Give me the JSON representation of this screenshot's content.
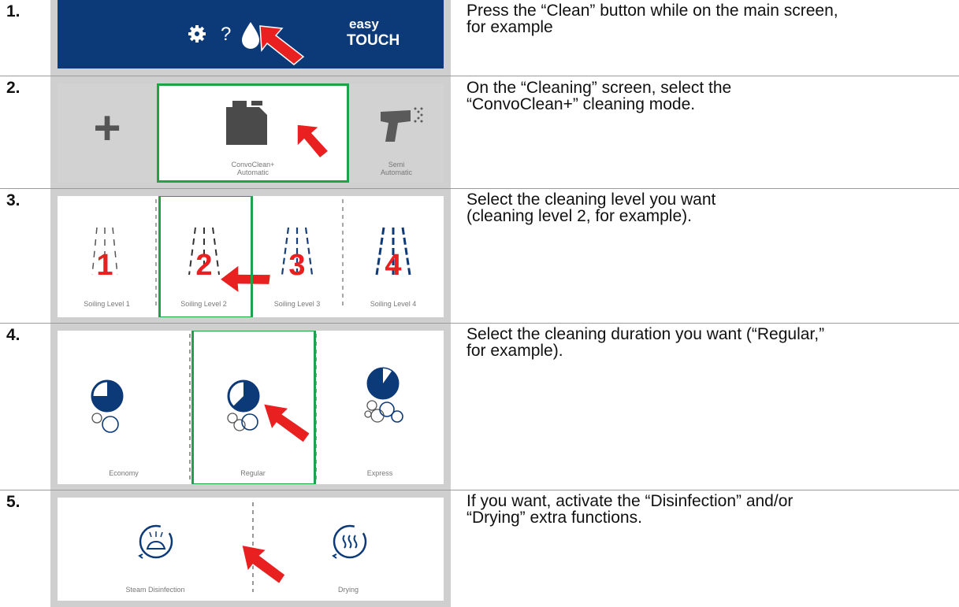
{
  "steps": [
    {
      "number": "1.",
      "text_lines": [
        "Press the “Clean” button while on the main screen,",
        "for example"
      ],
      "screen": {
        "logo_top": "easy",
        "logo_bottom": "TOUCH",
        "help_glyph": "?",
        "icons": [
          "gear-icon",
          "help-icon",
          "clean-drop-icon",
          "pointer-arrow-icon"
        ]
      }
    },
    {
      "number": "2.",
      "text_lines": [
        "On the “Cleaning” screen, select the",
        "“ConvoClean+” cleaning mode."
      ],
      "screen": {
        "add_glyph": "+",
        "modes": [
          {
            "label_line1": "ConvoClean+",
            "label_line2": "Automatic",
            "selected": true
          },
          {
            "label_line1": "Semi",
            "label_line2": "Automatic",
            "selected": false
          }
        ]
      }
    },
    {
      "number": "3.",
      "text_lines": [
        "Select the cleaning level you want",
        "(cleaning level 2, for example)."
      ],
      "screen": {
        "levels": [
          {
            "digit": "1",
            "label": "Soiling Level 1"
          },
          {
            "digit": "2",
            "label": "Soiling Level 2",
            "selected": true
          },
          {
            "digit": "3",
            "label": "Soiling Level 3"
          },
          {
            "digit": "4",
            "label": "Soiling Level 4"
          }
        ]
      }
    },
    {
      "number": "4.",
      "text_lines": [
        "Select the cleaning duration you want (“Regular,”",
        "for example)."
      ],
      "screen": {
        "durations": [
          {
            "label": "Economy",
            "fill_fraction": 0.75
          },
          {
            "label": "Regular",
            "fill_fraction": 0.625,
            "selected": true
          },
          {
            "label": "Express",
            "fill_fraction": 0.9
          }
        ]
      }
    },
    {
      "number": "5.",
      "text_lines": [
        "If you want, activate the “Disinfection” and/or",
        "“Drying” extra functions."
      ],
      "screen": {
        "extras": [
          {
            "label": "Steam Disinfection"
          },
          {
            "label": "Drying"
          }
        ]
      }
    }
  ],
  "colors": {
    "brand_blue": "#0c3a78",
    "accent_red": "#e8201f",
    "select_green": "#1fa24a",
    "panel_gray": "#cfcfcf"
  }
}
